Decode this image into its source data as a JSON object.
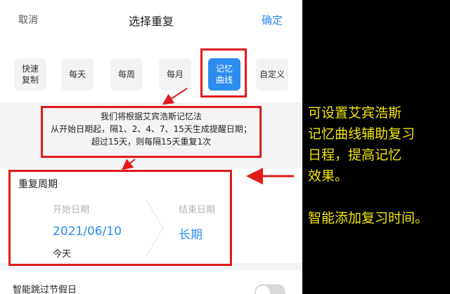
{
  "header": {
    "cancel": "取消",
    "title": "选择重复",
    "confirm": "确定"
  },
  "options": [
    {
      "label": "快速\n复制"
    },
    {
      "label": "每天"
    },
    {
      "label": "每周"
    },
    {
      "label": "每月"
    },
    {
      "label": "记忆\n曲线",
      "selected": true
    },
    {
      "label": "自定义"
    }
  ],
  "notice": {
    "line1": "我们将根据艾宾浩斯记忆法",
    "line2": "从开始日期起，隔1、2、4、7、15天生成提醒日期；",
    "line3": "超过15天，则每隔15天重复1次"
  },
  "period": {
    "title": "重复周期",
    "start_label": "开始日期",
    "start_value": "2021/06/10",
    "start_sub": "今天",
    "end_label": "结束日期",
    "end_value": "长期"
  },
  "holiday": {
    "label": "智能跳过节假日",
    "enabled": false
  },
  "caption": {
    "line1": "可设置艾宾浩斯",
    "line2": "记忆曲线辅助复习",
    "line3": "日程，提高记忆",
    "line4": "效果。",
    "line5": "智能添加复习时间。"
  },
  "colors": {
    "accent": "#2d8cf0",
    "annotation": "#e11b1b",
    "caption": "#f3e60a"
  }
}
